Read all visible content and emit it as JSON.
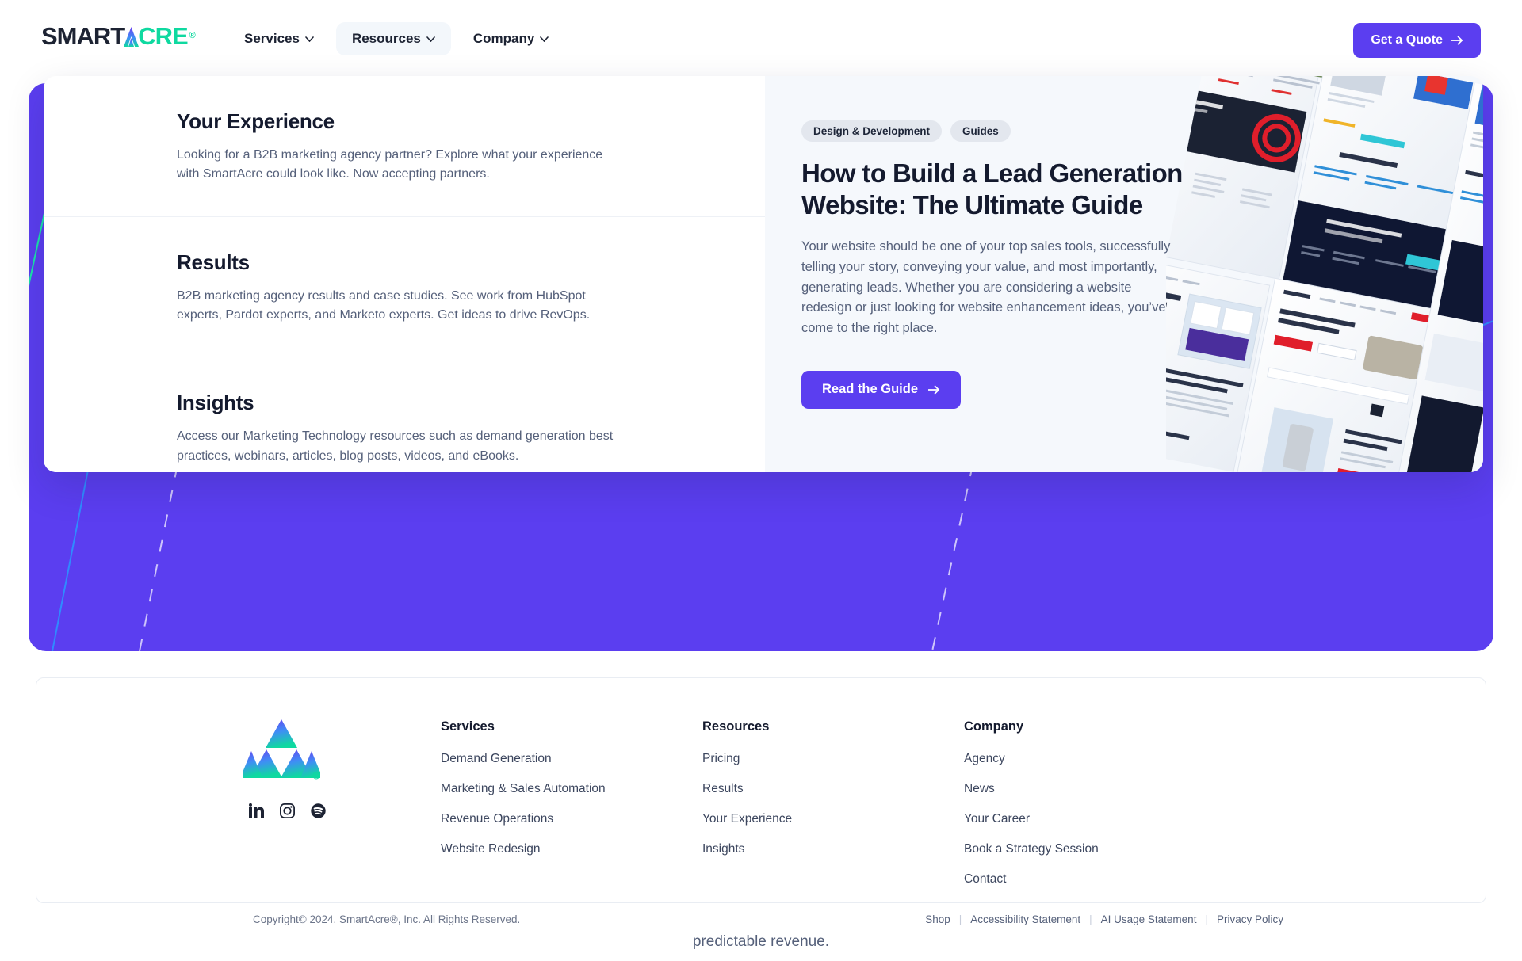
{
  "brand": {
    "name_part1": "SMART",
    "name_a": "A",
    "name_part2": "CRE",
    "registered": "®"
  },
  "header": {
    "nav": [
      {
        "label": "Services",
        "active": false
      },
      {
        "label": "Resources",
        "active": true
      },
      {
        "label": "Company",
        "active": false
      }
    ],
    "cta_label": "Get a Quote"
  },
  "mega_menu": {
    "sections": [
      {
        "title": "Your Experience",
        "description": "Looking for a B2B marketing agency partner? Explore what your experience with SmartAcre could look like. Now accepting partners."
      },
      {
        "title": "Results",
        "description": "B2B marketing agency results and case studies. See work from HubSpot experts, Pardot experts, and Marketo experts. Get ideas to drive RevOps."
      },
      {
        "title": "Insights",
        "description": "Access our Marketing Technology resources such as demand generation best practices, webinars, articles, blog posts, videos, and eBooks."
      }
    ],
    "featured": {
      "tags": [
        "Design & Development",
        "Guides"
      ],
      "title": "How to Build a Lead Generation Website: The Ultimate Guide",
      "description": "Your website should be one of your top sales tools, successfully telling your story, conveying your value, and most importantly, generating leads. Whether you are considering a website redesign or just looking for website enhancement ideas, you’ve come to the right place.",
      "button_label": "Read the Guide"
    }
  },
  "hero": {
    "background_color": "#5b3ef0"
  },
  "page_cut_text": "predictable revenue.",
  "footer": {
    "columns": [
      {
        "heading": "Services",
        "links": [
          "Demand Generation",
          "Marketing & Sales Automation",
          "Revenue Operations",
          "Website Redesign"
        ]
      },
      {
        "heading": "Resources",
        "links": [
          "Pricing",
          "Results",
          "Your Experience",
          "Insights"
        ]
      },
      {
        "heading": "Company",
        "links": [
          "Agency",
          "News",
          "Your Career",
          "Book a Strategy Session",
          "Contact"
        ]
      }
    ],
    "social": [
      "linkedin-icon",
      "instagram-icon",
      "spotify-icon"
    ],
    "copyright": "Copyright© 2024. SmartAcre®, Inc. All Rights Reserved.",
    "legal_links": [
      "Shop",
      "Accessibility Statement",
      "AI Usage Statement",
      "Privacy Policy"
    ]
  },
  "colors": {
    "purple": "#5b3ef0",
    "teal": "#0fd9a0",
    "ink": "#141a2e",
    "muted": "#55607a"
  }
}
